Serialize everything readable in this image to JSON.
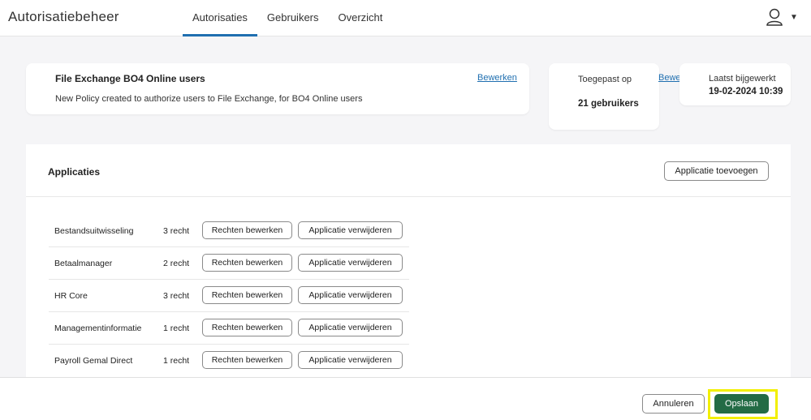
{
  "header": {
    "app_title": "Autorisatiebeheer",
    "tabs": [
      {
        "label": "Autorisaties",
        "active": true
      },
      {
        "label": "Gebruikers",
        "active": false
      },
      {
        "label": "Overzicht",
        "active": false
      }
    ],
    "user_icon": "user-icon",
    "menu_icon": "chevron-down-icon"
  },
  "policy": {
    "name": "File Exchange BO4 Online users",
    "description": "New Policy created to authorize users to File Exchange, for BO4 Online users",
    "edit_label": "Bewerken"
  },
  "applied": {
    "label": "Toegepast op",
    "value": "21 gebruikers",
    "edit_label": "Bewerken"
  },
  "updated": {
    "label": "Laatst bijgewerkt",
    "value": "19-02-2024 10:39"
  },
  "applications": {
    "title": "Applicaties",
    "add_label": "Applicatie toevoegen",
    "rows": [
      {
        "name": "Bestandsuitwisseling",
        "count": "3 recht",
        "edit": "Rechten bewerken",
        "remove": "Applicatie verwijderen"
      },
      {
        "name": "Betaalmanager",
        "count": "2 recht",
        "edit": "Rechten bewerken",
        "remove": "Applicatie verwijderen"
      },
      {
        "name": "HR Core",
        "count": "3 recht",
        "edit": "Rechten bewerken",
        "remove": "Applicatie verwijderen"
      },
      {
        "name": "Managementinformatie",
        "count": "1 recht",
        "edit": "Rechten bewerken",
        "remove": "Applicatie verwijderen"
      },
      {
        "name": "Payroll Gemal Direct",
        "count": "1 recht",
        "edit": "Rechten bewerken",
        "remove": "Applicatie verwijderen"
      }
    ]
  },
  "footer": {
    "cancel_label": "Annuleren",
    "save_label": "Opslaan"
  },
  "colors": {
    "accent": "#1f6fb0",
    "primary_button": "#236b45",
    "highlight": "#f2ef00"
  }
}
